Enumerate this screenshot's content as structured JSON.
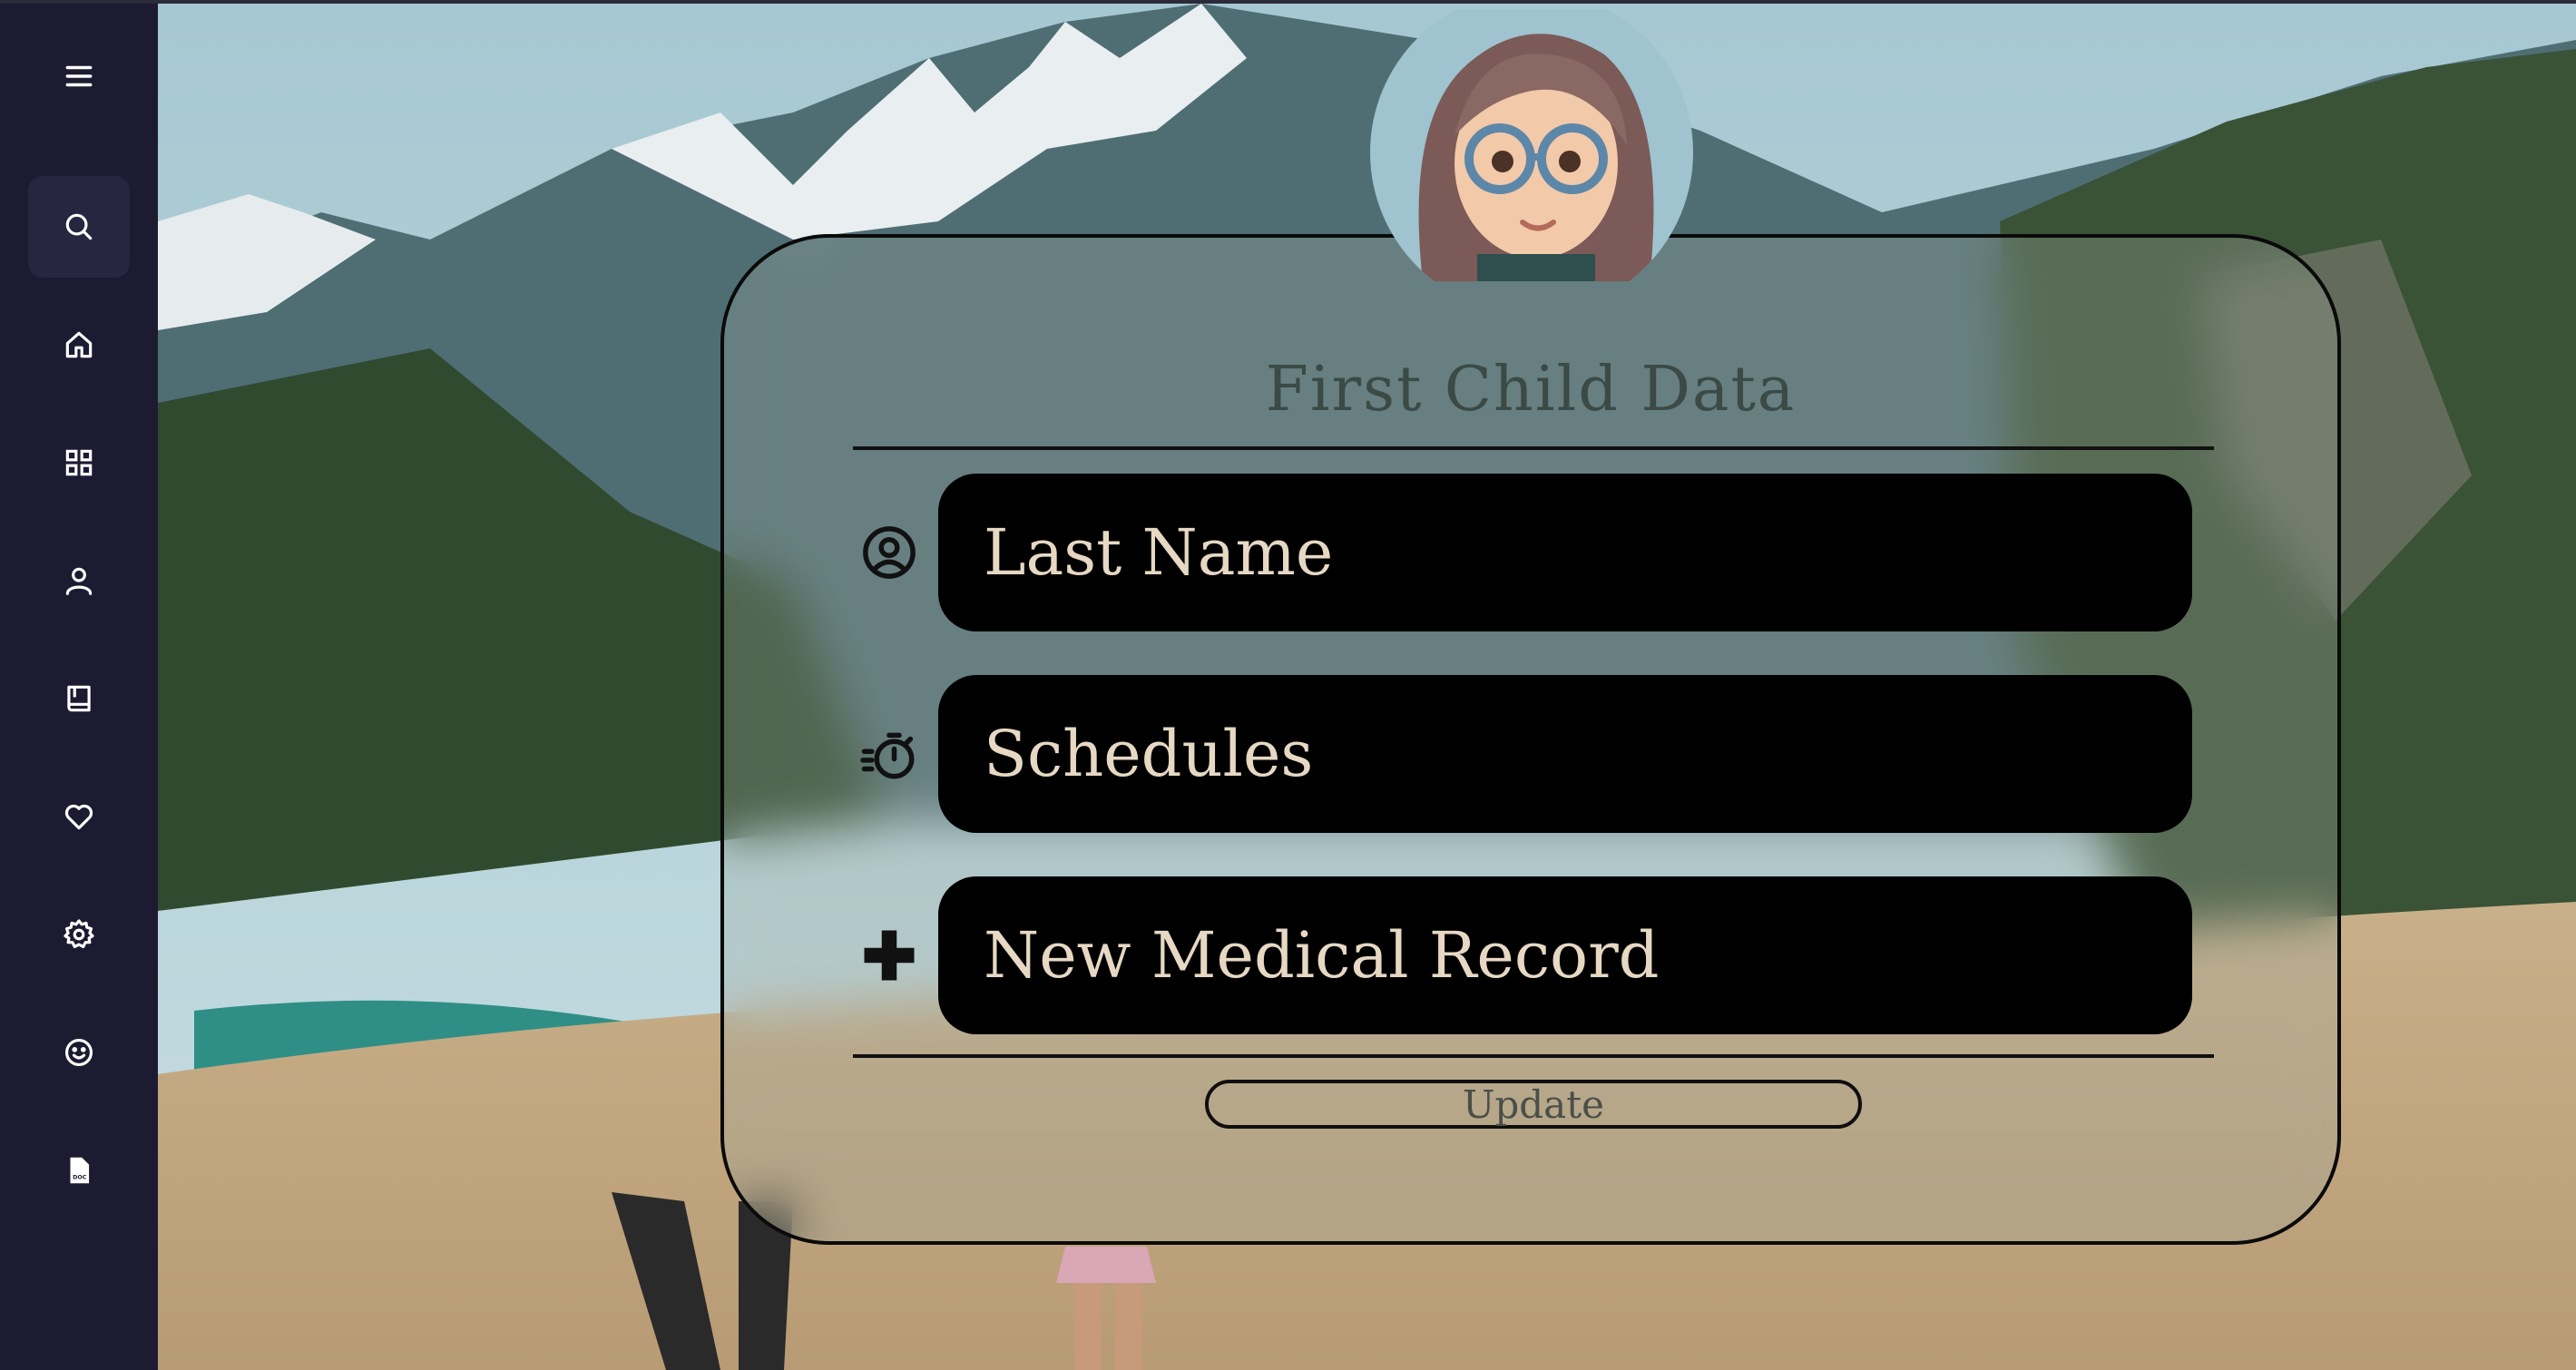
{
  "sidebar": {
    "items": [
      {
        "icon": "menu-icon"
      },
      {
        "icon": "search-icon",
        "active": true
      },
      {
        "icon": "home-icon"
      },
      {
        "icon": "grid-icon"
      },
      {
        "icon": "user-icon"
      },
      {
        "icon": "book-icon"
      },
      {
        "icon": "heart-icon"
      },
      {
        "icon": "gear-icon"
      },
      {
        "icon": "smile-icon"
      },
      {
        "icon": "doc-file-icon",
        "text": "DOC"
      }
    ],
    "background": "#1d1b31",
    "active_background": "#262641"
  },
  "card": {
    "title": "First Child Data",
    "fields": [
      {
        "icon": "user-circle-icon",
        "placeholder": "Last Name"
      },
      {
        "icon": "stopwatch-icon",
        "placeholder": "Schedules"
      },
      {
        "icon": "plus-icon",
        "placeholder": "New Medical Record"
      }
    ],
    "update_label": "Update"
  }
}
